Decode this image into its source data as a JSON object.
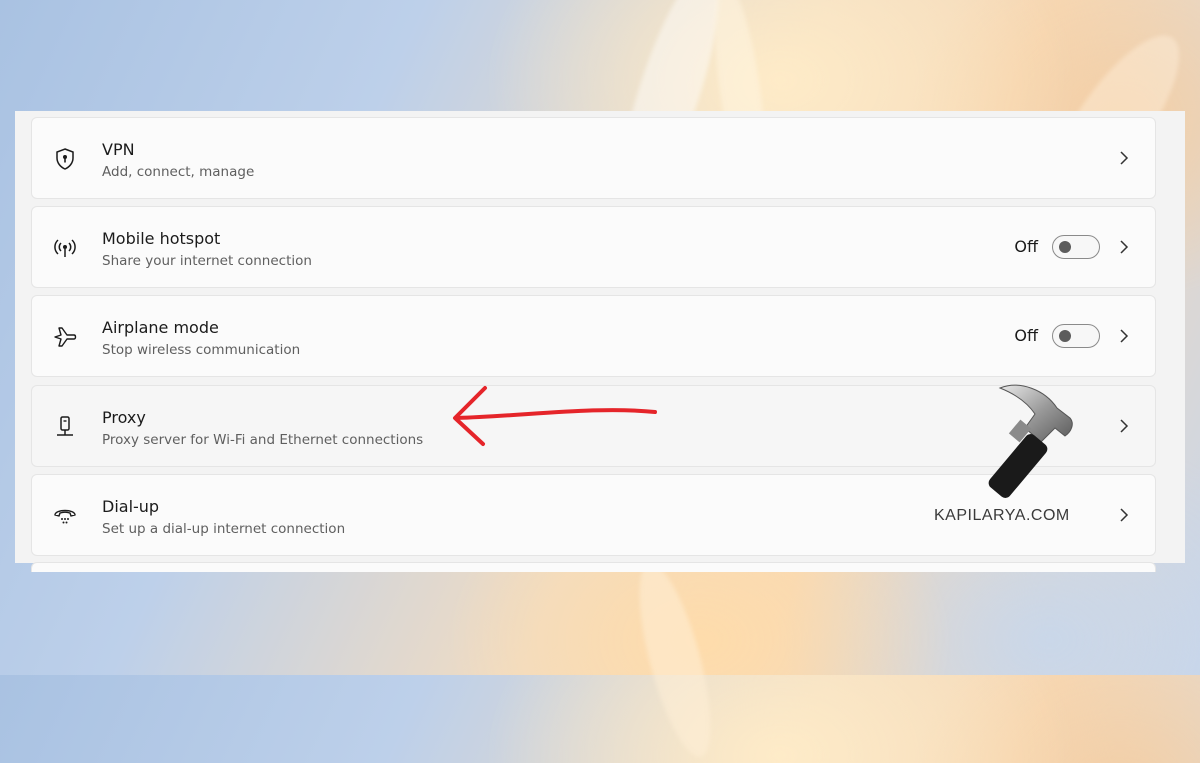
{
  "settings": {
    "items": [
      {
        "title": "VPN",
        "subtitle": "Add, connect, manage",
        "icon": "shield-icon"
      },
      {
        "title": "Mobile hotspot",
        "subtitle": "Share your internet connection",
        "icon": "hotspot-icon",
        "state": "Off",
        "toggle_on": false
      },
      {
        "title": "Airplane mode",
        "subtitle": "Stop wireless communication",
        "icon": "airplane-icon",
        "state": "Off",
        "toggle_on": false
      },
      {
        "title": "Proxy",
        "subtitle": "Proxy server for Wi-Fi and Ethernet connections",
        "icon": "proxy-icon",
        "highlighted": true
      },
      {
        "title": "Dial-up",
        "subtitle": "Set up a dial-up internet connection",
        "icon": "dialup-icon"
      }
    ]
  },
  "watermark": {
    "text": "KAPILARYA.COM",
    "icon": "hammer-icon"
  },
  "annotation": {
    "icon": "red-arrow-icon",
    "color": "#e5252a"
  }
}
